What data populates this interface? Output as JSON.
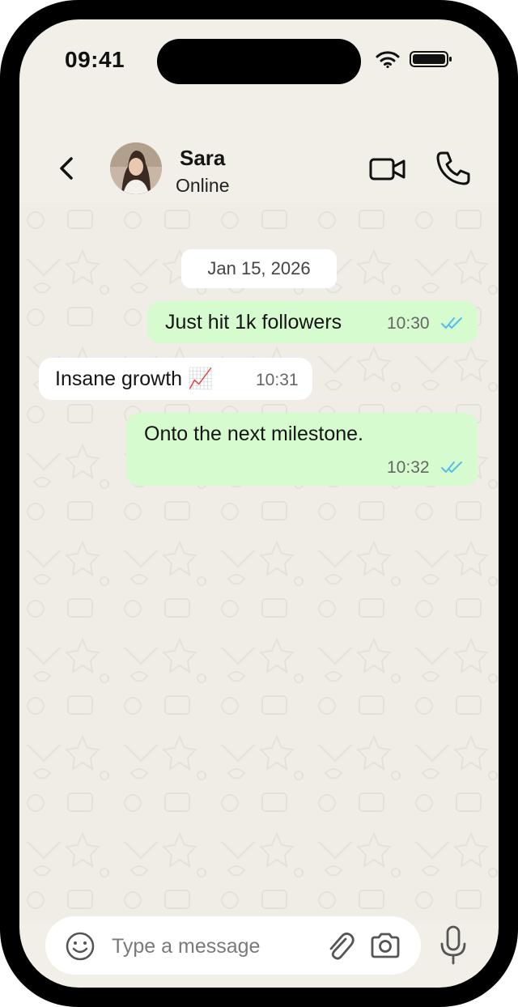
{
  "status_bar": {
    "time": "09:41"
  },
  "header": {
    "back_icon": "chevron-left-icon",
    "contact_name": "Sara",
    "contact_status": "Online",
    "video_icon": "video-camera-icon",
    "call_icon": "phone-icon"
  },
  "chat": {
    "date_label": "Jan 15, 2026",
    "messages": [
      {
        "direction": "outgoing",
        "text": "Just hit 1k followers",
        "time": "10:30",
        "status": "read"
      },
      {
        "direction": "incoming",
        "text": "Insane growth 📈",
        "time": "10:31"
      },
      {
        "direction": "outgoing",
        "text": "Onto the next milestone.",
        "time": "10:32",
        "status": "read"
      }
    ]
  },
  "composer": {
    "placeholder": "Type a message",
    "emoji_icon": "smile-icon",
    "attach_icon": "paperclip-icon",
    "camera_icon": "camera-icon",
    "mic_icon": "microphone-icon"
  },
  "colors": {
    "outgoing_bubble": "#d6fbcf",
    "incoming_bubble": "#ffffff",
    "chat_background": "#f0ede6",
    "read_ticks": "#53bdeb"
  }
}
